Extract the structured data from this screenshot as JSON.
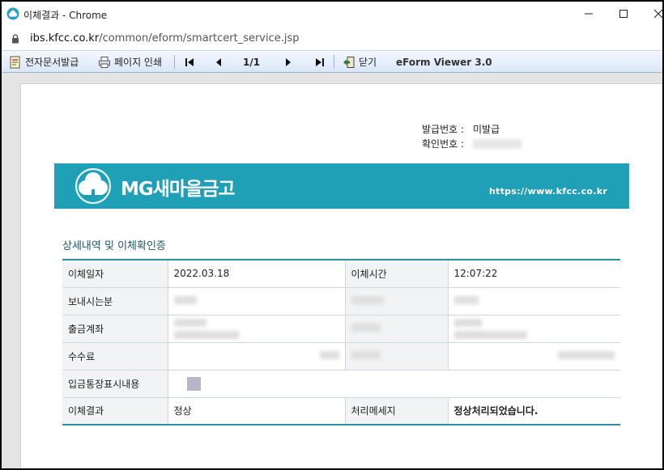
{
  "window": {
    "title": "이체결과 - Chrome",
    "url_host": "ibs.kfcc.co.kr",
    "url_path": "/common/eform/smartcert_service.jsp",
    "minimize_label": "—",
    "maximize_label": "☐",
    "close_label": "✕"
  },
  "toolbar": {
    "issue_doc_label": "전자문서발급",
    "print_label": "페이지 인쇄",
    "page_indicator": "1/1",
    "close_label": "닫기",
    "viewer_label": "eForm Viewer 3.0"
  },
  "document": {
    "issue_number_label": "발급번호 :",
    "issue_number_value": "미발급",
    "confirm_number_label": "확인번호 :",
    "banner_name": "MG새마을금고",
    "banner_url": "https://www.kfcc.co.kr",
    "section_title": "상세내역 및 이체확인증",
    "rows": {
      "transfer_date_label": "이체일자",
      "transfer_date_value": "2022.03.18",
      "transfer_time_label": "이체시간",
      "transfer_time_value": "12:07:22",
      "sender_label": "보내시는분",
      "withdraw_account_label": "출금계좌",
      "fee_label": "수수료",
      "deposit_memo_label": "입금통장표시내용",
      "result_label": "이체결과",
      "result_value": "정상",
      "message_label": "처리메세지",
      "message_value": "정상처리되었습니다."
    }
  },
  "colors": {
    "banner": "#1fa0b6",
    "table_border": "#2b8fa1",
    "section_title": "#1d5566"
  }
}
